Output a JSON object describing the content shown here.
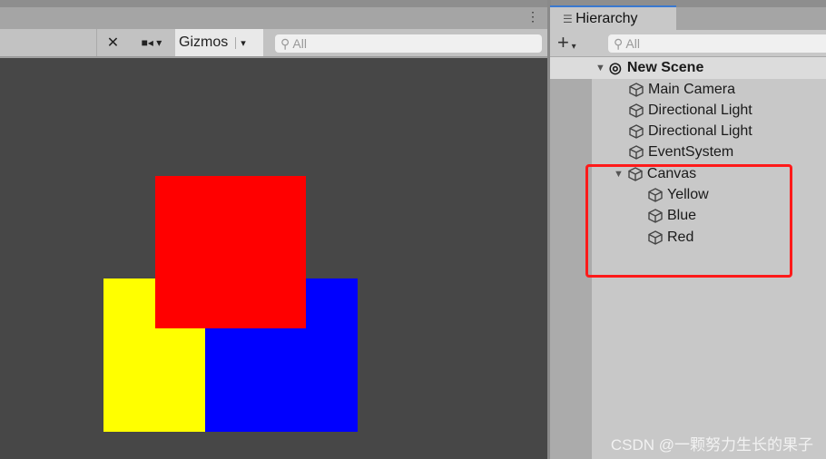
{
  "scene": {
    "toolbar": {
      "gizmos_label": "Gizmos",
      "search_placeholder": "All",
      "menu_icon": "kebab-icon",
      "tools_icon": "tools-icon",
      "camera_icon": "camera-icon"
    },
    "objects": [
      {
        "name": "yellow",
        "color": "#ffff00"
      },
      {
        "name": "blue",
        "color": "#0000ff"
      },
      {
        "name": "red",
        "color": "#ff0000"
      }
    ]
  },
  "hierarchy": {
    "tab_label": "Hierarchy",
    "search_placeholder": "All",
    "add_label": "+",
    "scene_name": "New Scene",
    "items": [
      "Main Camera",
      "Directional Light",
      "Directional Light",
      "EventSystem",
      "Canvas"
    ],
    "canvas_children": [
      "Yellow",
      "Blue",
      "Red"
    ],
    "highlight_color": "#ff1a1a"
  },
  "watermark": "CSDN @一颗努力生长的果子"
}
